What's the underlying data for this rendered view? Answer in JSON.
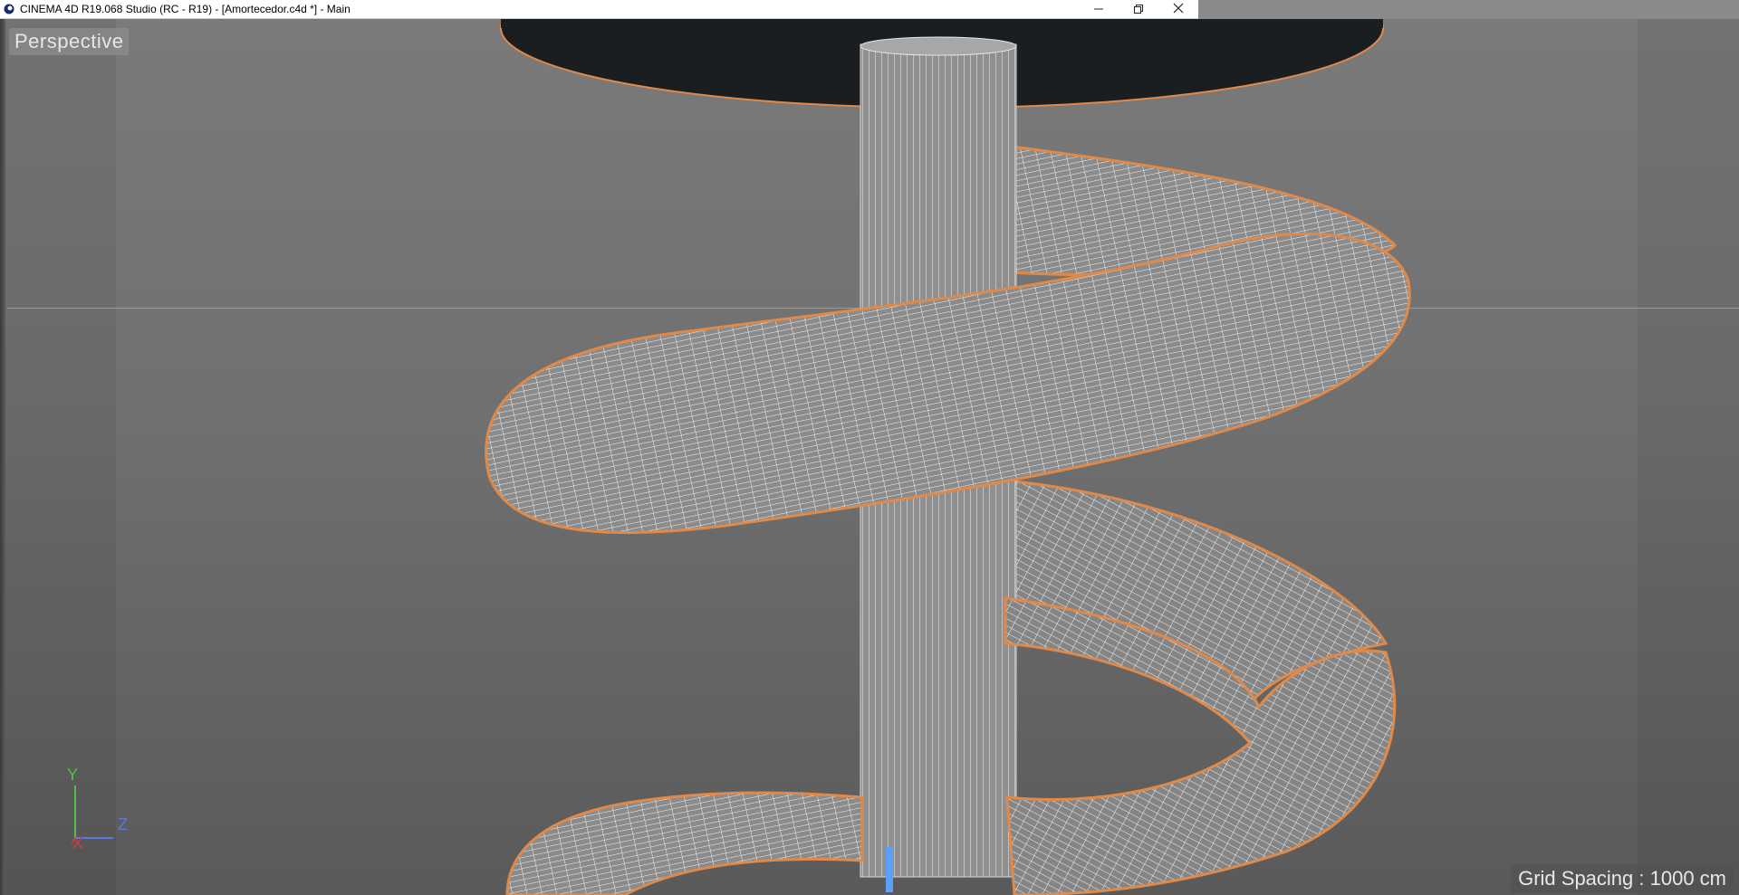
{
  "window": {
    "title": "CINEMA 4D R19.068 Studio (RC - R19) - [Amortecedor.c4d *] - Main",
    "controls": {
      "minimize_icon": "minimize-icon",
      "restore_icon": "restore-icon",
      "close_icon": "close-icon"
    }
  },
  "viewport": {
    "camera_label": "Perspective",
    "grid_spacing_text": "Grid Spacing : 1000 cm",
    "axes": {
      "y": "Y",
      "z": "Z",
      "x": "X"
    }
  },
  "colors": {
    "selection_outline": "#e08a4a",
    "wire": "#f2f2f2",
    "disc": "#1b1e20",
    "axis_y": "#4cc24c",
    "axis_z": "#5a78e0",
    "axis_x": "#d03a3a"
  }
}
